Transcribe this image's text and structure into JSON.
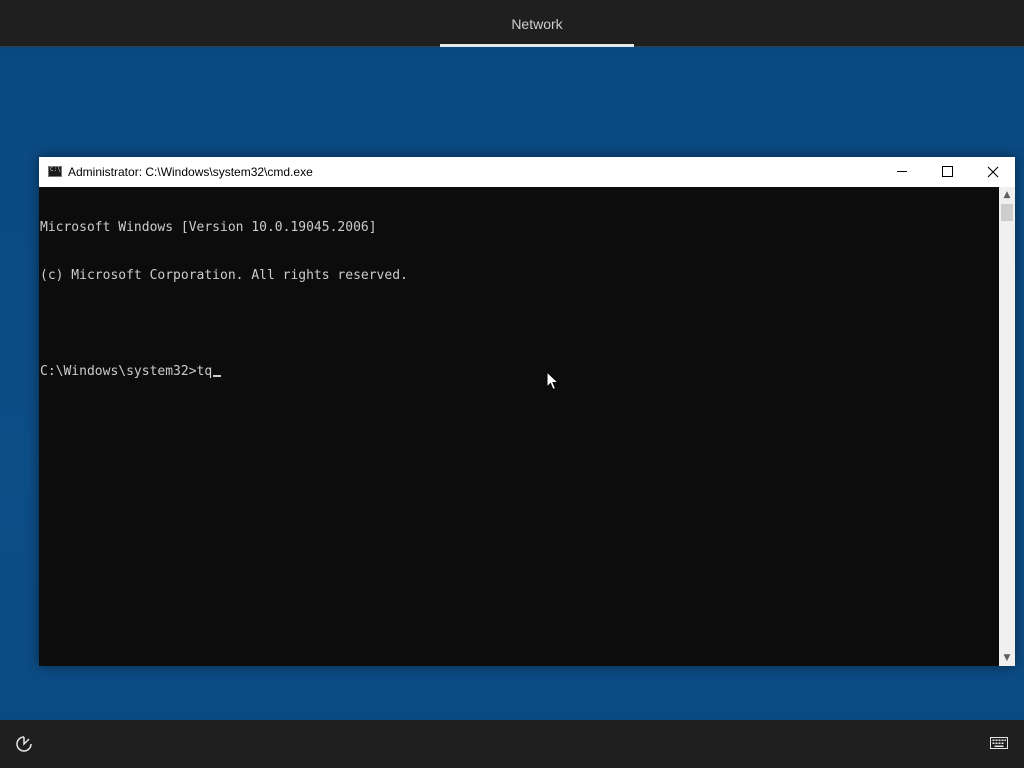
{
  "topbar": {
    "tab_label": "Network"
  },
  "cmd_window": {
    "title": "Administrator: C:\\Windows\\system32\\cmd.exe",
    "lines": [
      "Microsoft Windows [Version 10.0.19045.2006]",
      "(c) Microsoft Corporation. All rights reserved.",
      "",
      "C:\\Windows\\system32>tq"
    ],
    "icons": {
      "app": "cmd-icon",
      "minimize": "minimize-icon",
      "maximize": "maximize-icon",
      "close": "close-icon"
    }
  },
  "bottombar": {
    "icons": [
      "ease-of-access-icon",
      "keyboard-icon"
    ]
  },
  "colors": {
    "desktop": "#0b4a82",
    "bar": "#1f1f1f",
    "console_bg": "#0c0c0c",
    "console_text": "#cccccc"
  }
}
